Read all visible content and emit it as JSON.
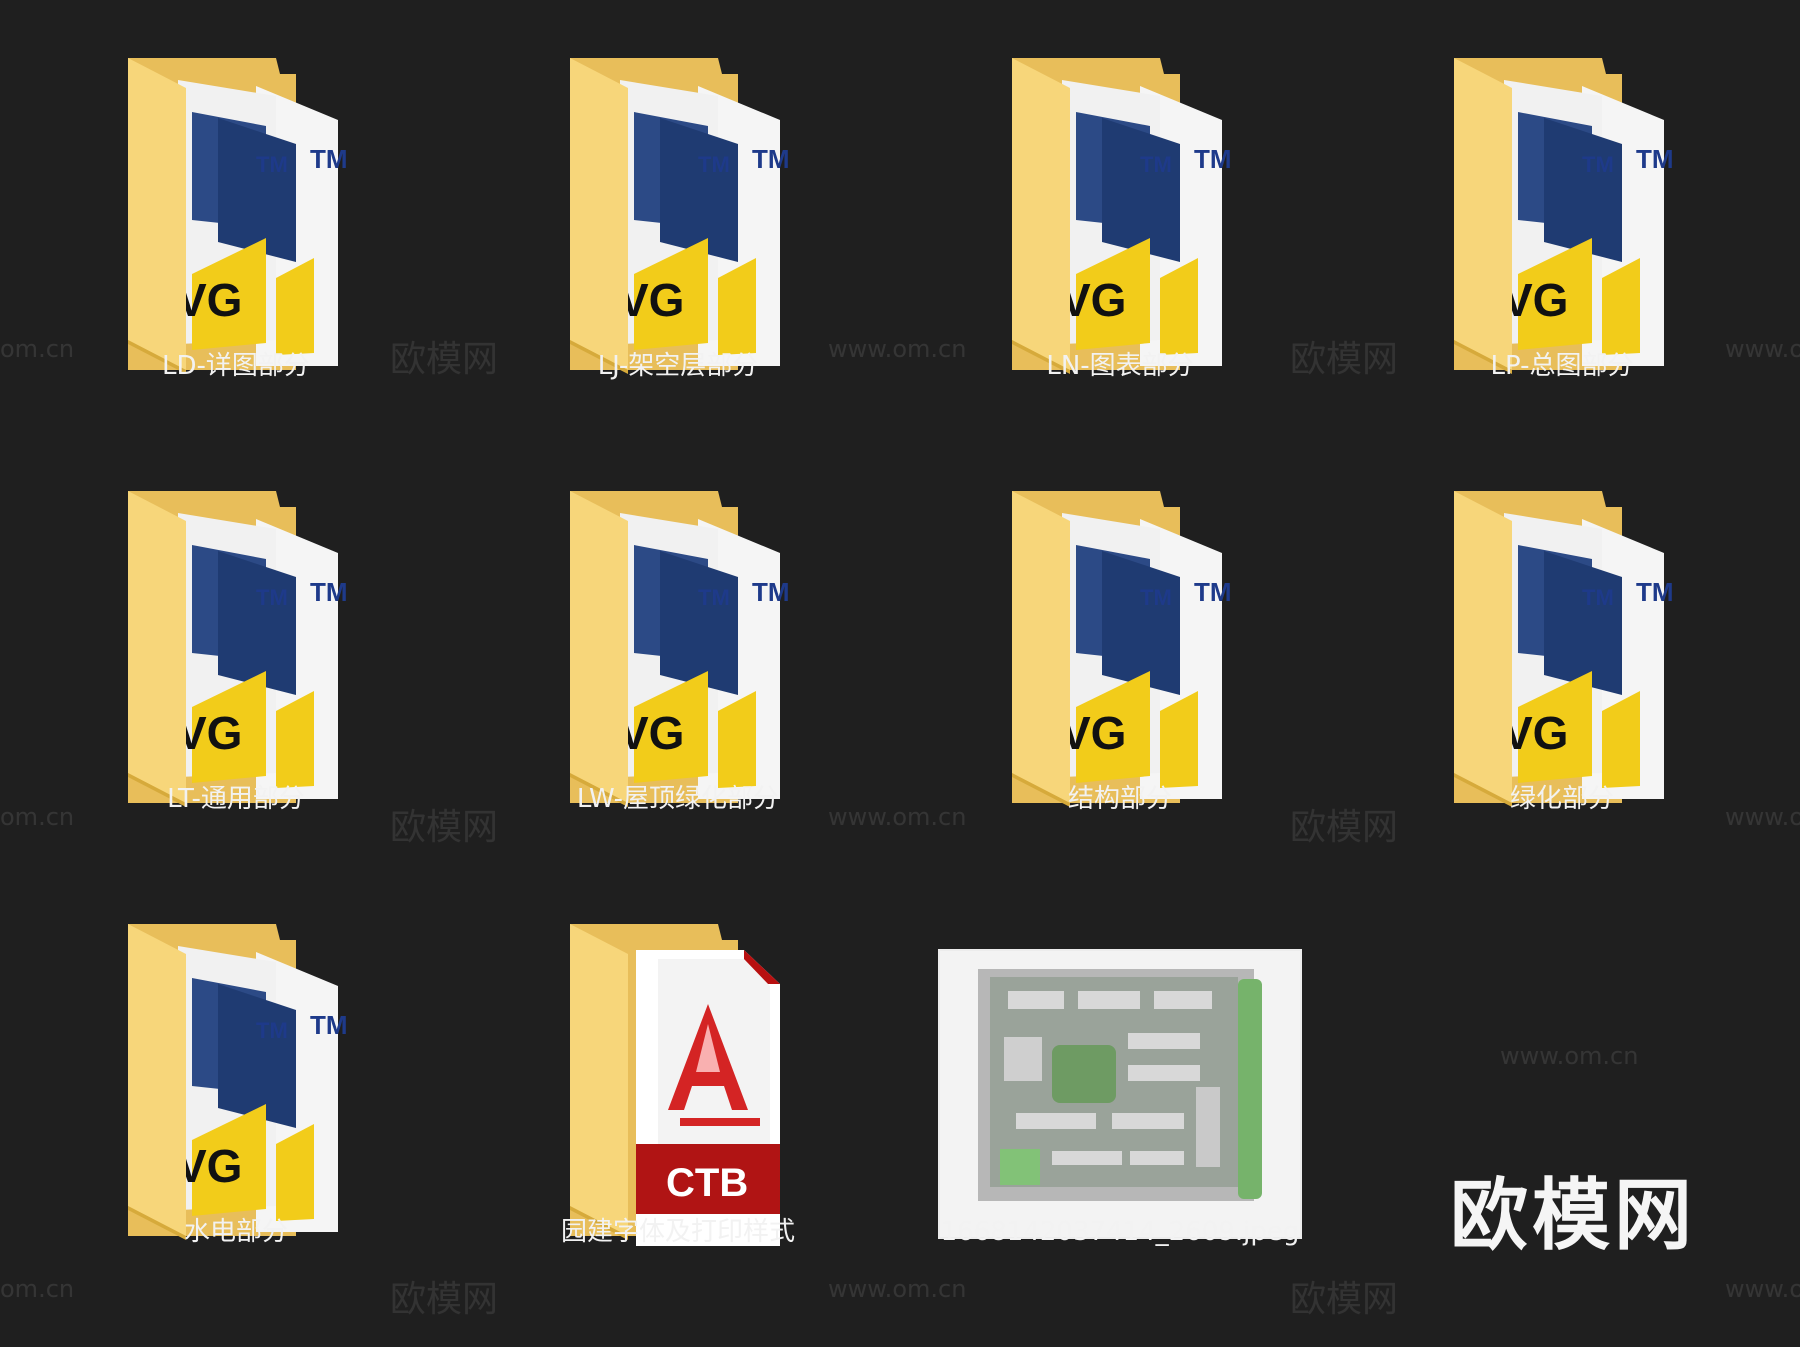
{
  "files": [
    {
      "name": "LD-详图部分",
      "type": "folder"
    },
    {
      "name": "LJ-架空层部分",
      "type": "folder"
    },
    {
      "name": "LN-图表部分",
      "type": "folder"
    },
    {
      "name": "LP-总图部分",
      "type": "folder"
    },
    {
      "name": "LT-通用部分",
      "type": "folder"
    },
    {
      "name": "LW-屋顶绿化部分",
      "type": "folder"
    },
    {
      "name": "结构部分",
      "type": "folder"
    },
    {
      "name": "绿化部分",
      "type": "folder"
    },
    {
      "name": "水电部分",
      "type": "folder"
    },
    {
      "name": "园建字体及打印样式",
      "type": "folder-ctb"
    },
    {
      "name": "1668142037414_2609.jpeg",
      "type": "image"
    }
  ],
  "dwg_badge": {
    "tm": "TM",
    "vg": "VG"
  },
  "ctb_badge": "CTB",
  "watermark": {
    "url_text": "www.om.cn",
    "partial_url": "om.cn",
    "cn_text": "欧模网"
  },
  "brand_mark": "欧模网",
  "colors": {
    "background": "#1f1f1f",
    "folder": "#f7d67a",
    "dwg_yellow": "#f2cc1a",
    "ctb_red": "#c41a1a"
  }
}
